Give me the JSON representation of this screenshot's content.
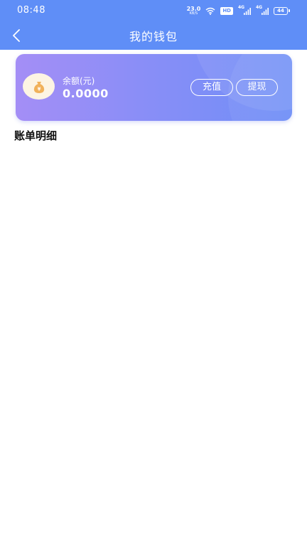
{
  "status_bar": {
    "time": "08:48",
    "net_speed_value": "23.0",
    "net_speed_unit": "KB/S",
    "hd_label": "HD",
    "signal_1_label": "4G",
    "signal_2_label": "4G",
    "battery_level": "44"
  },
  "header": {
    "title": "我的钱包"
  },
  "wallet_card": {
    "balance_label": "余额(元)",
    "balance_value": "0.0000",
    "recharge_label": "充值",
    "withdraw_label": "提现",
    "wallet_icon": "money-bag-icon"
  },
  "bill_section": {
    "title": "账单明细"
  },
  "colors": {
    "header_bg": "#5f8ef7",
    "card_gradient_start": "#a48ef6",
    "card_gradient_end": "#6f8ff7",
    "icon_bg": "#fdf4e3",
    "icon_fg": "#f1b15a"
  }
}
